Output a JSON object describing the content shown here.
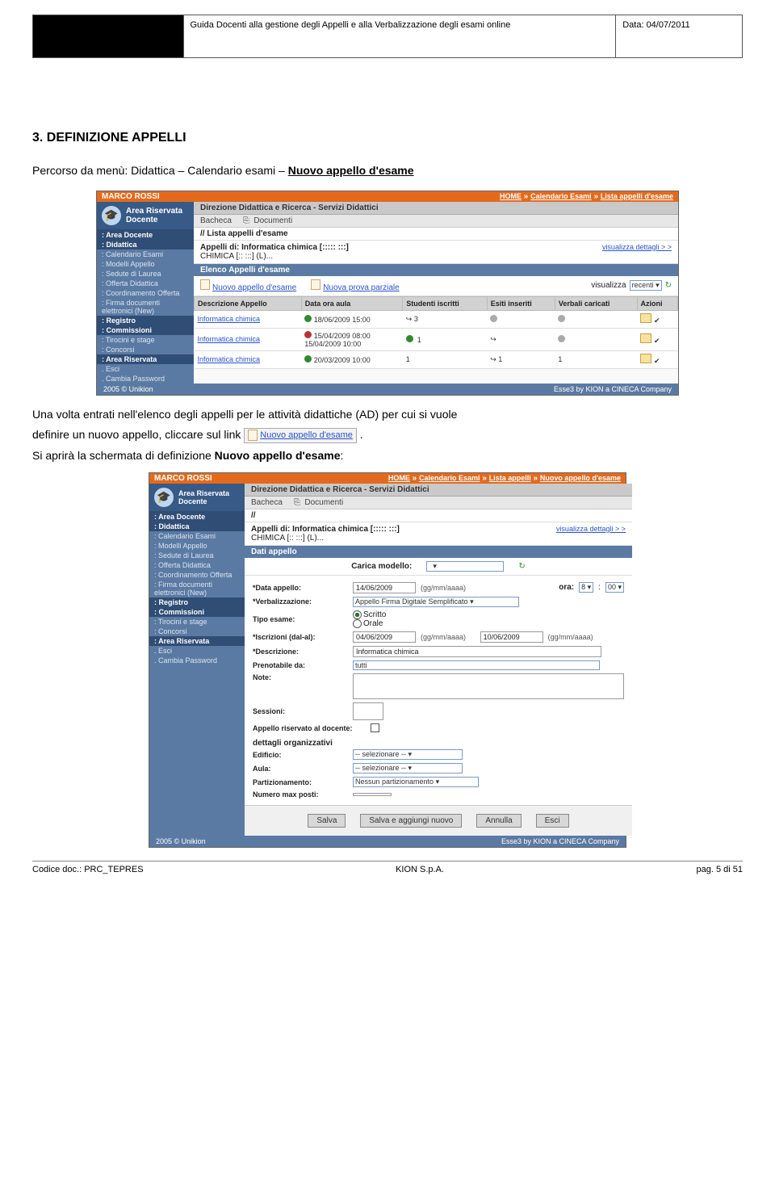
{
  "header": {
    "title": "Guida Docenti alla gestione degli Appelli e alla Verbalizzazione degli esami online",
    "date_label": "Data: 04/07/2011"
  },
  "section_title": "3. DEFINIZIONE APPELLI",
  "intro_prefix": "Percorso da menù: Didattica – Calendario esami – ",
  "intro_link": "Nuovo appello d'esame",
  "para1": "Una volta entrati nell'elenco degli appelli per le attività didattiche (AD) per cui si vuole",
  "para2_pre": "definire un nuovo appello, cliccare sul link ",
  "inline_link": "Nuovo appello d'esame",
  "para2_post": " .",
  "para3_pre": "Si aprirà la schermata di definizione ",
  "para3_bold": "Nuovo appello d'esame",
  "para3_post": ":",
  "shot1": {
    "user": "MARCO ROSSI",
    "bc_home": "HOME",
    "bc_1": "Calendario Esami",
    "bc_2": "Lista appelli d'esame",
    "dir_title": "Direzione Didattica e Ricerca - Servizi Didattici",
    "tab1": "Bacheca",
    "tab2": "Documenti",
    "path": "// Lista appelli d'esame",
    "appelli_di": "Appelli di: Informatica chimica [::::: :::]",
    "chimica": "CHIMICA [:: :::] (L)...",
    "vis_dett": "visualizza dettagli > >",
    "elenco_hdr": "Elenco Appelli d'esame",
    "nl_new_appello": "Nuovo appello d'esame",
    "nl_new_parziale": "Nuova prova parziale",
    "visualizza_lbl": "visualizza",
    "visualizza_val": "recenti",
    "cols": [
      "Descrizione Appello",
      "Data ora aula",
      "Studenti iscritti",
      "Esiti inseriti",
      "Verbali caricati",
      "Azioni"
    ],
    "rows": [
      {
        "desc": "Informatica chimica",
        "date": "18/06/2009 15:00",
        "stud": "3",
        "esiti": "",
        "verb": "",
        "azioni": ""
      },
      {
        "desc": "Informatica chimica",
        "date": "15/04/2009 08:00\n15/04/2009 10:00",
        "stud": "1",
        "esiti": "",
        "verb": "",
        "azioni": ""
      },
      {
        "desc": "Informatica chimica",
        "date": "20/03/2009 10:00",
        "stud": "1",
        "esiti": "1",
        "verb": "1",
        "azioni": ""
      }
    ],
    "foot_left": "2005 © Unikion",
    "foot_right": "Esse3 by KION a CINECA Company",
    "side": {
      "ar_title": "Area Riservata\nDocente",
      "cats": {
        "area_docente": ": Area Docente",
        "didattica": ": Didattica",
        "didattica_items": [
          ": Calendario Esami",
          ": Modelli Appello",
          ": Sedute di Laurea",
          ": Offerta Didattica",
          ": Coordinamento Offerta",
          ": Firma documenti  elettronici (New)"
        ],
        "registro": ": Registro",
        "commissioni": ": Commissioni",
        "comm_items": [
          ": Tirocini e stage",
          ": Concorsi"
        ],
        "area_ris": ": Area Riservata",
        "ar_items": [
          ". Esci",
          ". Cambia Password"
        ]
      }
    }
  },
  "shot2": {
    "user": "MARCO ROSSI",
    "bc_home": "HOME",
    "bc_1": "Calendario Esami",
    "bc_2": "Lista appelli",
    "bc_3": "Nuovo appello d'esame",
    "dir_title": "Direzione Didattica e Ricerca - Servizi Didattici",
    "tab1": "Bacheca",
    "tab2": "Documenti",
    "path": "//",
    "appelli_di": "Appelli di: Informatica chimica [::::: :::]",
    "chimica": "CHIMICA [:: :::] (L)...",
    "vis_dett": "visualizza dettagli > >",
    "dati_hdr": "Dati appello",
    "carica_modello": "Carica modello:",
    "form": {
      "data_appello_lbl": "*Data appello:",
      "data_appello_val": "14/06/2009",
      "ggmm": "(gg/mm/aaaa)",
      "ora_lbl": "ora:",
      "ora_h": "8",
      "ora_m": "00",
      "verb_lbl": "*Verbalizzazione:",
      "verb_val": "Appello Firma Digitale Semplificato",
      "tipo_lbl": "Tipo esame:",
      "tipo_scritto": "Scritto",
      "tipo_orale": "Orale",
      "iscr_lbl": "*Iscrizioni (dal-al):",
      "iscr_da": "04/06/2009",
      "iscr_a": "10/06/2009",
      "descr_lbl": "*Descrizione:",
      "descr_val": "Informatica chimica",
      "pren_lbl": "Prenotabile da:",
      "pren_val": "tutti",
      "note_lbl": "Note:",
      "sess_lbl": "Sessioni:",
      "ris_lbl": "Appello riservato al docente:",
      "dett_hdr": "dettagli organizzativi",
      "edif_lbl": "Edificio:",
      "edif_val": "-- selezionare --",
      "aula_lbl": "Aula:",
      "aula_val": "-- selezionare --",
      "part_lbl": "Partizionamento:",
      "part_val": "Nessun partizionamento",
      "num_lbl": "Numero max posti:"
    },
    "buttons": [
      "Salva",
      "Salva e aggiungi nuovo",
      "Annulla",
      "Esci"
    ],
    "foot_left": "2005 © Unikion",
    "foot_right": "Esse3 by KION a CINECA Company",
    "side": {
      "ar_title": "Area Riservata\nDocente",
      "cats": {
        "area_docente": ": Area Docente",
        "didattica": ": Didattica",
        "didattica_items": [
          ": Calendario Esami",
          ": Modelli Appello",
          ": Sedute di Laurea",
          ": Offerta Didattica",
          ": Coordinamento Offerta",
          ": Firma documenti elettronici (New)"
        ],
        "registro": ": Registro",
        "commissioni": ": Commissioni",
        "comm_items": [
          ": Tirocini e stage",
          ": Concorsi"
        ],
        "area_ris": ": Area Riservata",
        "ar_items": [
          ". Esci",
          ". Cambia Password"
        ]
      }
    }
  },
  "footer": {
    "left": "Codice doc.: PRC_TEPRES",
    "center": "KION S.p.A.",
    "right": "pag. 5 di 51"
  }
}
